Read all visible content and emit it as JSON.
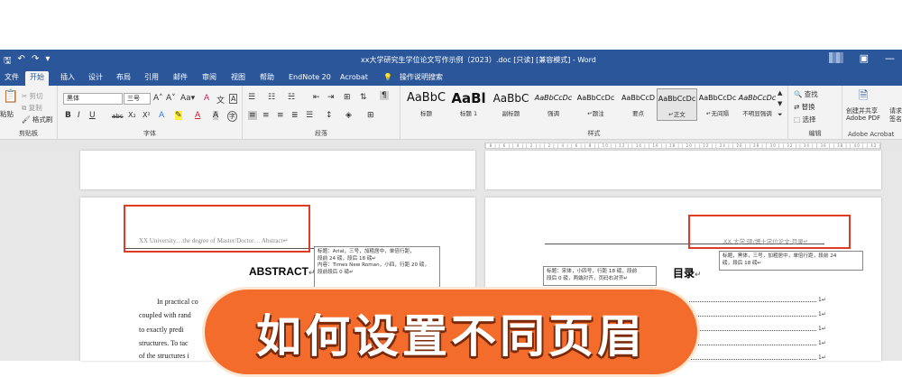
{
  "window": {
    "title": "xx大学研究生学位论文写作示例（2023）.doc [只读] [兼容模式] - Word",
    "qat": [
      "🖫",
      "↶",
      "↷",
      "▾"
    ]
  },
  "tabs": [
    "文件",
    "开始",
    "插入",
    "设计",
    "布局",
    "引用",
    "邮件",
    "审阅",
    "视图",
    "帮助",
    "EndNote 20",
    "Acrobat",
    "💡",
    "操作说明搜索"
  ],
  "ribbon": {
    "clipboard": {
      "paste": "粘贴",
      "cut": "剪切",
      "copy": "复制",
      "format_painter": "格式刷",
      "label": "剪贴板"
    },
    "font": {
      "name": "黑体",
      "size": "三号",
      "grow": "A˄",
      "shrink": "A˅",
      "case": "Aa▾",
      "clear": "A",
      "phonetic": "文",
      "border": "A",
      "bold": "B",
      "italic": "I",
      "underline": "U",
      "strike": "abc",
      "sub": "X₂",
      "sup": "X²",
      "effects": "A",
      "highlight": "✎",
      "color": "A",
      "shade": "A",
      "enclose": "字",
      "label": "字体"
    },
    "paragraph": {
      "label": "段落"
    },
    "styles": {
      "label": "样式",
      "items": [
        {
          "preview": "AaBbC",
          "label": "标题"
        },
        {
          "preview": "AaBl",
          "label": "标题 1"
        },
        {
          "preview": "AaBbC",
          "label": "副标题"
        },
        {
          "preview": "AaBbCcDc",
          "label": "强调"
        },
        {
          "preview": "AaBbCcDc",
          "label": "↵题注"
        },
        {
          "preview": "AaBbCcD",
          "label": "要点"
        },
        {
          "preview": "AaBbCcDc",
          "label": "↵正文"
        },
        {
          "preview": "AaBbCcDc",
          "label": "↵无间隔"
        },
        {
          "preview": "AaBbCcDc",
          "label": "不明显强调"
        }
      ]
    },
    "editing": {
      "find": "查找",
      "replace": "替换",
      "select": "选择",
      "label": "编辑"
    },
    "acrobat": {
      "create": "创建并共享",
      "create2": "Adobe PDF",
      "request": "请求",
      "request2": "签名",
      "label": "Adobe Acrobat"
    }
  },
  "ruler_marks": "| 8 | | 6 | | 4 | | 2 | |   | 2 | | 4 | | 6 | | 8 | | 10 | | 12 | | 14 | | 16 | | 18 | | 20 | | 22 | | 24 | | 26 | | 28 | | 30 | | 32 | | 34 | | 36 | | 38 | | 40 | | 42 | | 44 | | 46 | | 48 |",
  "left_page": {
    "header": "XX University…the degree of Master/Doctor… Abstract↵",
    "callout": [
      "标题：Arial，三号，加粗居中，单倍行距，",
      "段前 24 磅，段后 18 磅↵",
      "内容：Times New Roman，小四，行距 20 磅，",
      "段前段后 0 磅↵"
    ],
    "heading": "ABSTRACT",
    "heading_mark": "↵",
    "body": [
      "In   practical   co",
      "coupled with rand",
      "to exactly predi",
      "structures. To tac",
      "of the structures i"
    ]
  },
  "right_page": {
    "header": "XX 大学·硕/博士学位论文·目录↵",
    "callout_top": [
      "标题，黑体，三号，加粗居中，单倍行距，段前 24",
      "磅，段后 18 磅↵"
    ],
    "callout_left": [
      "标题：宋体，小四号，行距 18 磅，段前",
      "段后 0 磅，两端对齐，页码右对齐↵"
    ],
    "heading": "目录",
    "heading_mark": "↵",
    "toc_pages": [
      "1↵",
      "1↵",
      "1↵",
      "1↵",
      "1↵"
    ]
  },
  "overlay": {
    "text": "如何设置不同页眉"
  },
  "colors": {
    "word_blue": "#2b579a",
    "highlight_red": "#e03b24",
    "overlay_orange": "#f46c2c"
  }
}
